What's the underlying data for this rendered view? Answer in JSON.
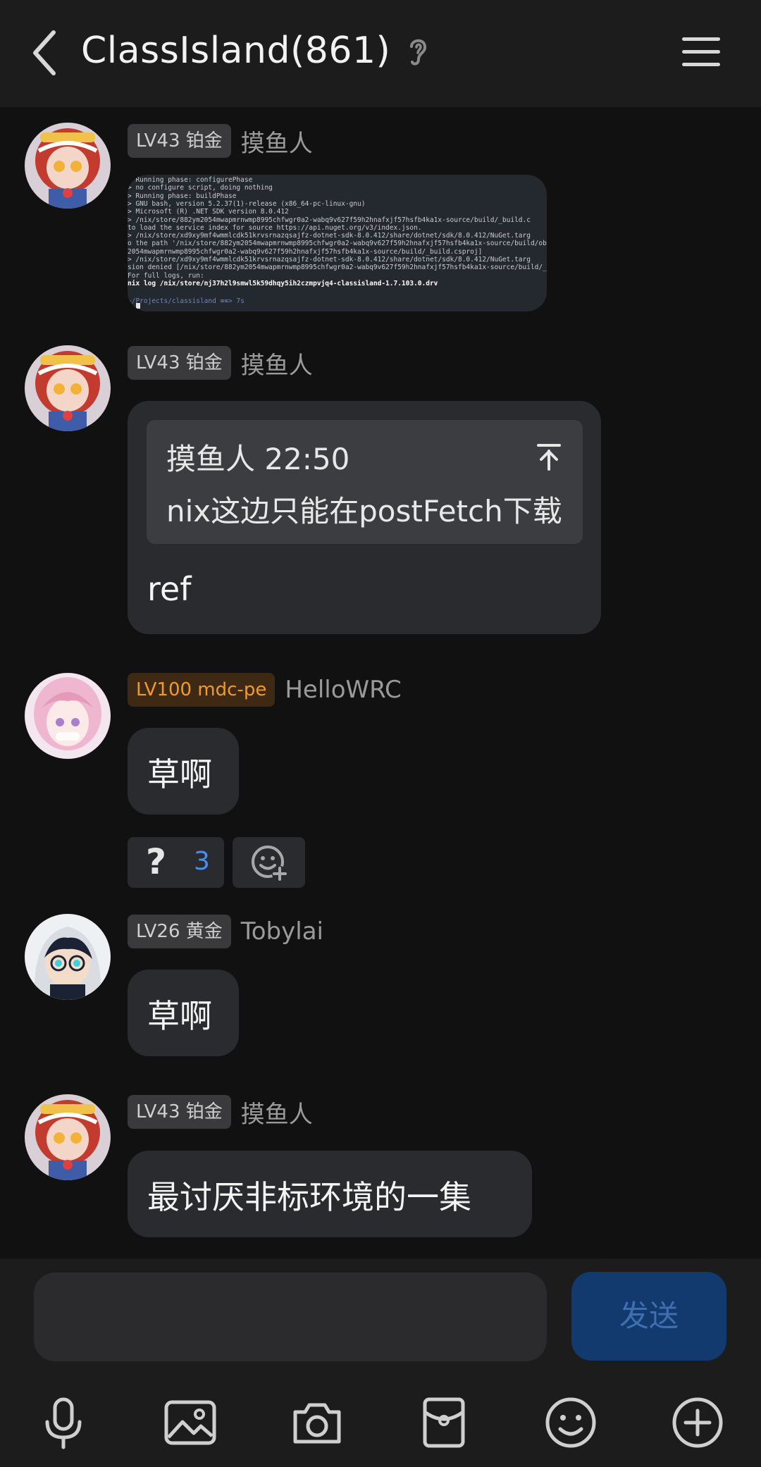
{
  "header": {
    "title": "ClassIsland(861)",
    "icons": {
      "back": "back-chevron-icon",
      "ear": "ear-icon",
      "menu": "menu-icon"
    }
  },
  "messages": [
    {
      "type": "image",
      "badge": "LV43 铂金",
      "sender": "摸鱼人",
      "terminal_lines": [
        "      > Running phase: configurePhase",
        "      > no configure script, doing nothing",
        "      > Running phase: buildPhase",
        "      > GNU bash, version 5.2.37(1)-release (x86_64-pc-linux-gnu)",
        "      > Microsoft (R) .NET SDK version 8.0.412",
        "      > /nix/store/882ym2054mwapmrnwmp8995chfwgr0a2-wabq9v627f59h2hnafxjf57hsfb4ka1x-source/build/_build.c",
        " to load the service index for source https://api.nuget.org/v3/index.json.",
        "      > /nix/store/xd9xy9mf4wmmlcdk51krvsrnazqsajfz-dotnet-sdk-8.0.412/share/dotnet/sdk/8.0.412/NuGet.targ",
        "o the path '/nix/store/882ym2054mwapmrnwmp8995chfwgr0a2-wabq9v627f59h2hnafxjf57hsfb4ka1x-source/build/obj'",
        "2054mwapmrnwmp8995chfwgr0a2-wabq9v627f59h2hnafxjf57hsfb4ka1x-source/build/_build.csproj]",
        "      > /nix/store/xd9xy9mf4wmmlcdk51krvsrnazqsajfz-dotnet-sdk-8.0.412/share/dotnet/sdk/8.0.412/NuGet.targ",
        "sion denied [/nix/store/882ym2054mwapmrnwmp8995chfwgr0a2-wabq9v627f59h2hnafxjf57hsfb4ka1x-source/build/_bui",
        "       For full logs, run:",
        "         nix log /nix/store/nj37h2l9smwl5k59dhqy5ih2czmpvjq4-classisland-1.7.103.0.drv",
        "~/Projects/classisland ≡≡> 7s"
      ]
    },
    {
      "type": "quote",
      "badge": "LV43 铂金",
      "sender": "摸鱼人",
      "quote_meta": "摸鱼人 22:50",
      "quote_text": "nix这边只能在postFetch下载",
      "text": "ref"
    },
    {
      "type": "text",
      "badge": "LV100 mdc-pe",
      "sender": "HelloWRC",
      "text": "草啊",
      "reactions": {
        "question_count": "3"
      }
    },
    {
      "type": "text",
      "badge": "LV26 黄金",
      "sender": "Tobylai",
      "text": "草啊"
    },
    {
      "type": "text",
      "badge": "LV43 铂金",
      "sender": "摸鱼人",
      "text": "最讨厌非标环境的一集"
    }
  ],
  "input": {
    "placeholder": "",
    "send_label": "发送"
  },
  "toolbar": [
    "microphone-icon",
    "image-icon",
    "camera-icon",
    "red-packet-icon",
    "emoji-icon",
    "plus-icon"
  ],
  "colors": {
    "background": "#111111",
    "bubble": "#2a2b2e",
    "accent_blue": "#4a8ff0",
    "badge_orange": "#f19a2c"
  }
}
